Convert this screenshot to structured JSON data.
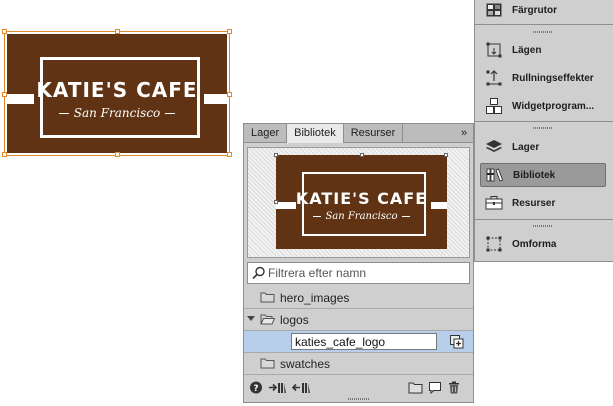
{
  "canvas_logo": {
    "title": "KATIE'S CAFE",
    "subtitle": "San Francisco",
    "brand_brown": "#5f3313",
    "selection_color": "#e08a2c"
  },
  "library_panel": {
    "tabs": [
      {
        "label": "Lager",
        "active": false
      },
      {
        "label": "Bibliotek",
        "active": true
      },
      {
        "label": "Resurser",
        "active": false
      }
    ],
    "more_label": "»",
    "preview": {
      "title": "KATIE'S CAFE",
      "subtitle": "San Francisco"
    },
    "search": {
      "placeholder": "Filtrera efter namn",
      "value": "",
      "icon": "search-icon"
    },
    "items": [
      {
        "label": "hero_images",
        "type": "folder",
        "expanded": false
      },
      {
        "label": "logos",
        "type": "folder",
        "expanded": true
      },
      {
        "label": "katies_cafe_logo",
        "type": "asset",
        "editing": true,
        "selected": true
      },
      {
        "label": "swatches",
        "type": "folder",
        "expanded": false
      }
    ],
    "footer_icons": [
      "help-icon",
      "import-icon",
      "export-icon",
      "new-folder-icon",
      "new-item-icon",
      "trash-icon"
    ]
  },
  "window_menu": {
    "items": [
      {
        "label": "Färgrutor",
        "icon": "swatches-icon",
        "active": false
      },
      {
        "label": "Lägen",
        "icon": "states-icon",
        "active": false
      },
      {
        "label": "Rullningseffekter",
        "icon": "scroll-effects-icon",
        "active": false
      },
      {
        "label": "Widgetprogram...",
        "icon": "widget-icon",
        "active": false
      },
      {
        "label": "Lager",
        "icon": "layers-icon",
        "active": false
      },
      {
        "label": "Bibliotek",
        "icon": "library-icon",
        "active": true
      },
      {
        "label": "Resurser",
        "icon": "assets-icon",
        "active": false
      },
      {
        "label": "Omforma",
        "icon": "transform-icon",
        "active": false
      }
    ],
    "active_bg": "#9a9a9a"
  }
}
